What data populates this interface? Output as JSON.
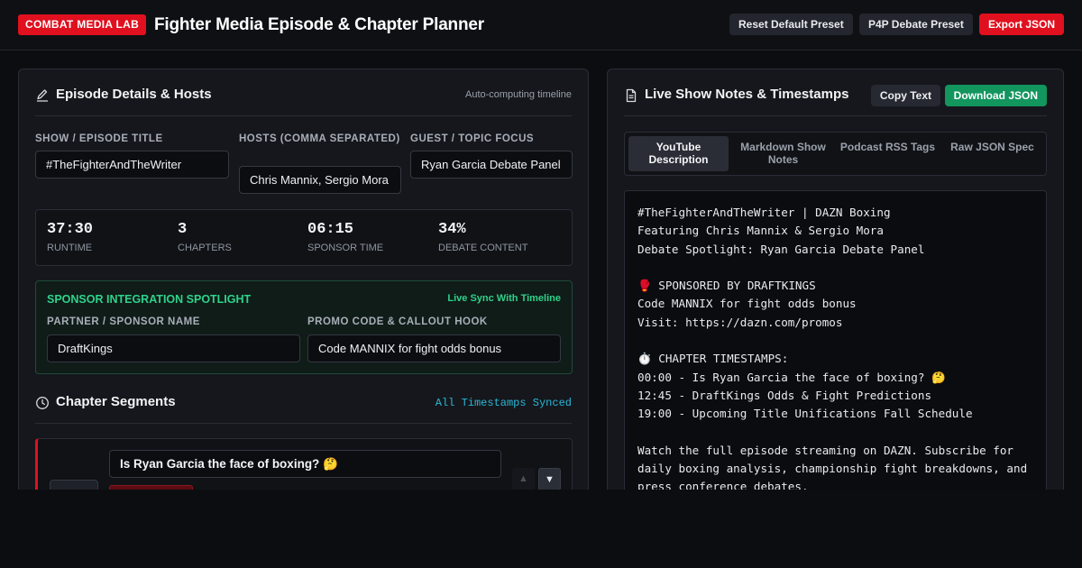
{
  "header": {
    "brand": "COMBAT MEDIA LAB",
    "title": "Fighter Media Episode & Chapter Planner",
    "buttons": {
      "reset": "Reset Default Preset",
      "p4p": "P4P Debate Preset",
      "export": "Export JSON"
    }
  },
  "left": {
    "title": "Episode Details & Hosts",
    "note": "Auto-computing timeline",
    "fields": {
      "show_label": "SHOW / EPISODE TITLE",
      "show_value": "#TheFighterAndTheWriter",
      "hosts_label": "HOSTS (COMMA SEPARATED)",
      "hosts_value": "Chris Mannix, Sergio Mora",
      "guest_label": "GUEST / TOPIC FOCUS",
      "guest_value": "Ryan Garcia Debate Panel"
    },
    "stats": [
      {
        "value": "37:30",
        "label": "RUNTIME"
      },
      {
        "value": "3",
        "label": "CHAPTERS"
      },
      {
        "value": "06:15",
        "label": "SPONSOR TIME"
      },
      {
        "value": "34%",
        "label": "DEBATE CONTENT"
      }
    ],
    "sponsor": {
      "title": "SPONSOR INTEGRATION SPOTLIGHT",
      "sync": "Live Sync With Timeline",
      "partner_label": "PARTNER / SPONSOR NAME",
      "partner_value": "DraftKings",
      "promo_label": "PROMO CODE & CALLOUT HOOK",
      "promo_value": "Code MANNIX for fight odds bonus"
    },
    "chapters": {
      "title": "Chapter Segments",
      "sync": "All Timestamps Synced",
      "items": [
        {
          "title": "Is Ryan Garcia the face of boxing? 🤔"
        }
      ],
      "up": "▲",
      "down": "▼"
    }
  },
  "right": {
    "title": "Live Show Notes & Timestamps",
    "copy": "Copy Text",
    "download": "Download JSON",
    "tabs": [
      "YouTube Description",
      "Markdown Show Notes",
      "Podcast RSS Tags",
      "Raw JSON Spec"
    ],
    "notes": "#TheFighterAndTheWriter | DAZN Boxing\nFeaturing Chris Mannix & Sergio Mora\nDebate Spotlight: Ryan Garcia Debate Panel\n\n🥊 SPONSORED BY DRAFTKINGS\nCode MANNIX for fight odds bonus\nVisit: https://dazn.com/promos\n\n⏱️ CHAPTER TIMESTAMPS:\n00:00 - Is Ryan Garcia the face of boxing? 🤔\n12:45 - DraftKings Odds & Fight Predictions\n19:00 - Upcoming Title Unifications Fall Schedule\n\nWatch the full episode streaming on DAZN. Subscribe for daily boxing analysis, championship fight breakdowns, and press conference debates."
  },
  "icons": {
    "edit": "pencil-icon",
    "clock": "clock-icon",
    "doc": "document-icon"
  }
}
